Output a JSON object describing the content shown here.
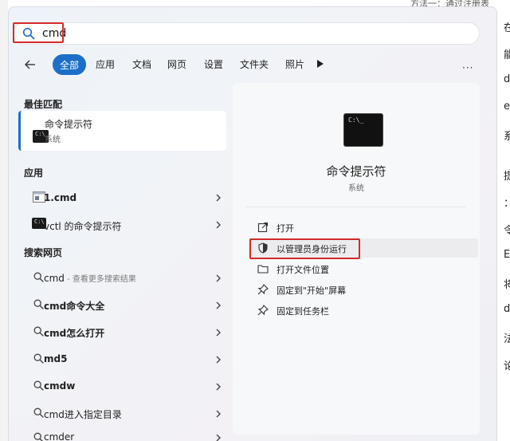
{
  "background": {
    "top_text": "方法一：通过注册表",
    "side_chars": [
      "在",
      "能",
      "do",
      "ev",
      "系",
      "提",
      "：",
      "令",
      "E",
      "将",
      "d",
      "法",
      "论"
    ]
  },
  "search": {
    "value": "cmd"
  },
  "filters": {
    "back_label": "←",
    "chips": [
      "全部",
      "应用",
      "文档",
      "网页",
      "设置",
      "文件夹",
      "照片"
    ],
    "more_label": "···"
  },
  "best_match": {
    "section_label": "最佳匹配",
    "title": "命令提示符",
    "subtitle": "系统"
  },
  "apps": {
    "section_label": "应用",
    "items": [
      "1.cmd",
      "vctl 的命令提示符"
    ]
  },
  "web": {
    "section_label": "搜索网页",
    "first": {
      "term": "cmd",
      "hint": " - 查看更多搜索结果"
    },
    "items": [
      "cmd命令大全",
      "cmd怎么打开",
      "md5",
      "cmdw",
      "cmd进入指定目录",
      "cmder"
    ]
  },
  "detail": {
    "title": "命令提示符",
    "subtitle": "系统",
    "actions": [
      "打开",
      "以管理员身份运行",
      "打开文件位置",
      "固定到\"开始\"屏幕",
      "固定到任务栏"
    ]
  },
  "colors": {
    "accent": "#1c6fc8",
    "highlight": "#d42a2a"
  }
}
